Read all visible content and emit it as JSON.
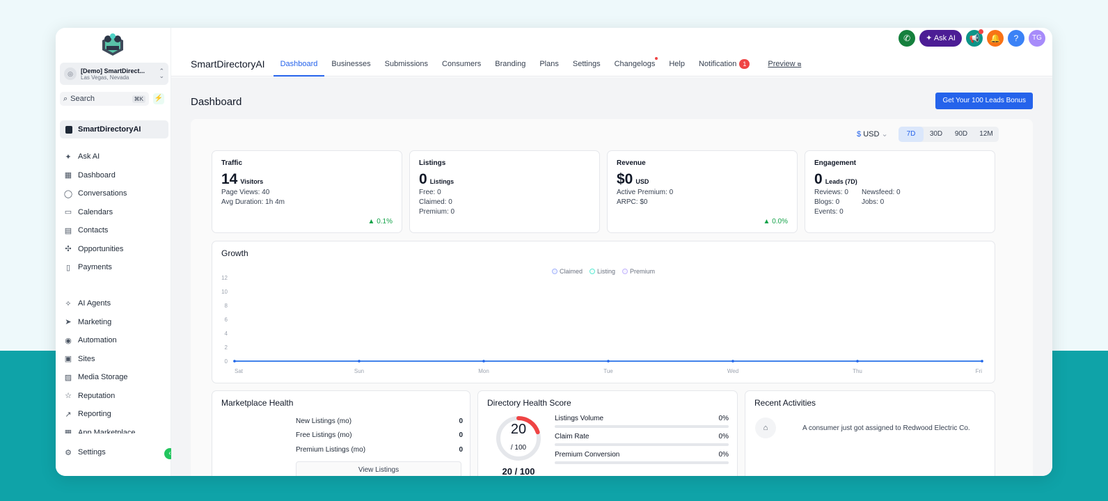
{
  "sidebar": {
    "account": {
      "name": "[Demo] SmartDirect...",
      "location": "Las Vegas, Nevada"
    },
    "search": {
      "placeholder": "Search",
      "shortcut": "⌘K"
    },
    "org": "SmartDirectoryAI",
    "nav_primary": [
      {
        "label": "Ask AI",
        "icon": "sparkle-icon",
        "glyph": "✦"
      },
      {
        "label": "Dashboard",
        "icon": "grid-icon",
        "glyph": "▦"
      },
      {
        "label": "Conversations",
        "icon": "chat-icon",
        "glyph": "◯"
      },
      {
        "label": "Calendars",
        "icon": "calendar-icon",
        "glyph": "▭"
      },
      {
        "label": "Contacts",
        "icon": "contacts-icon",
        "glyph": "▤"
      },
      {
        "label": "Opportunities",
        "icon": "opportunities-icon",
        "glyph": "✣"
      },
      {
        "label": "Payments",
        "icon": "payments-icon",
        "glyph": "▯"
      }
    ],
    "nav_secondary": [
      {
        "label": "AI Agents",
        "icon": "ai-agents-icon",
        "glyph": "✧"
      },
      {
        "label": "Marketing",
        "icon": "send-icon",
        "glyph": "➤"
      },
      {
        "label": "Automation",
        "icon": "automation-icon",
        "glyph": "◉"
      },
      {
        "label": "Sites",
        "icon": "sites-icon",
        "glyph": "▣"
      },
      {
        "label": "Media Storage",
        "icon": "image-icon",
        "glyph": "▨"
      },
      {
        "label": "Reputation",
        "icon": "star-icon",
        "glyph": "☆"
      },
      {
        "label": "Reporting",
        "icon": "trend-icon",
        "glyph": "↗"
      },
      {
        "label": "App Marketplace",
        "icon": "marketplace-icon",
        "glyph": "▦"
      }
    ],
    "settings": {
      "label": "Settings",
      "glyph": "⚙"
    }
  },
  "topbar": {
    "ask_ai": "Ask AI",
    "avatar_initials": "TG",
    "help_glyph": "?"
  },
  "tabs": {
    "brand": "SmartDirectoryAI",
    "items": [
      "Dashboard",
      "Businesses",
      "Submissions",
      "Consumers",
      "Branding",
      "Plans",
      "Settings",
      "Changelogs",
      "Help",
      "Notification",
      "Preview"
    ],
    "notification_count": "1"
  },
  "page": {
    "title": "Dashboard",
    "bonus_button": "Get Your 100 Leads Bonus"
  },
  "filters": {
    "currency": "USD",
    "currency_symbol": "$",
    "ranges": [
      "7D",
      "30D",
      "90D",
      "12M"
    ],
    "active_range": "7D"
  },
  "stats": {
    "traffic": {
      "label": "Traffic",
      "value": "14",
      "unit": "Visitors",
      "lines": [
        "Page Views: 40",
        "Avg Duration: 1h 4m"
      ],
      "change": "▲ 0.1%"
    },
    "listings": {
      "label": "Listings",
      "value": "0",
      "unit": "Listings",
      "lines": [
        "Free: 0",
        "Claimed: 0",
        "Premium: 0"
      ]
    },
    "revenue": {
      "label": "Revenue",
      "value": "$0",
      "unit": "USD",
      "lines": [
        "Active Premium: 0",
        "ARPC: $0"
      ],
      "change": "▲ 0.0%"
    },
    "engagement": {
      "label": "Engagement",
      "value": "0",
      "unit": "Leads (7D)",
      "grid": [
        "Reviews: 0",
        "Newsfeed: 0",
        "Blogs: 0",
        "Jobs: 0",
        "Events: 0"
      ]
    }
  },
  "growth": {
    "title": "Growth",
    "legend": [
      "Claimed",
      "Listing",
      "Premium"
    ]
  },
  "chart_data": {
    "type": "line",
    "title": "Growth",
    "categories": [
      "Sat",
      "Sun",
      "Mon",
      "Tue",
      "Wed",
      "Thu",
      "Fri"
    ],
    "yticks": [
      0,
      2,
      4,
      6,
      8,
      10,
      12
    ],
    "ylim": [
      0,
      12
    ],
    "series": [
      {
        "name": "Claimed",
        "values": [
          0,
          0,
          0,
          0,
          0,
          0,
          0
        ],
        "color": "#2563eb"
      },
      {
        "name": "Listing",
        "values": [
          0,
          0,
          0,
          0,
          0,
          0,
          0
        ],
        "color": "#5eead4"
      },
      {
        "name": "Premium",
        "values": [
          0,
          0,
          0,
          0,
          0,
          0,
          0
        ],
        "color": "#a5b4fc"
      }
    ],
    "legend": "top-center"
  },
  "marketplace_health": {
    "title": "Marketplace Health",
    "rows": [
      {
        "label": "New Listings (mo)",
        "value": "0"
      },
      {
        "label": "Free Listings (mo)",
        "value": "0"
      },
      {
        "label": "Premium Listings (mo)",
        "value": "0"
      }
    ],
    "button": "View Listings"
  },
  "health_score": {
    "title": "Directory Health Score",
    "score": "20",
    "of": "/ 100",
    "score_value": 20,
    "summary": "20 / 100",
    "metrics": [
      {
        "label": "Listings Volume",
        "value": "0%"
      },
      {
        "label": "Claim Rate",
        "value": "0%"
      },
      {
        "label": "Premium Conversion",
        "value": "0%"
      }
    ]
  },
  "recent_activities": {
    "title": "Recent Activities",
    "items": [
      "A consumer just got assigned to Redwood Electric Co."
    ]
  },
  "colors": {
    "accent": "#2563eb",
    "positive": "#16a34a",
    "danger": "#ef4444",
    "teal_bg": "#0fa3a8"
  }
}
